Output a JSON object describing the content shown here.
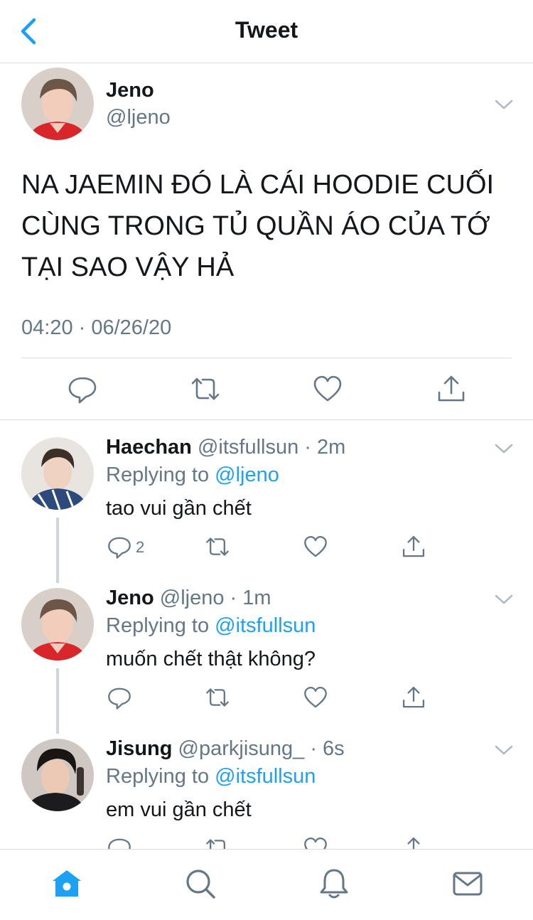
{
  "header": {
    "title": "Tweet",
    "back_icon": "back-chevron-icon"
  },
  "main_tweet": {
    "author_name": "Jeno",
    "handle": "@ljeno",
    "text": "NA JAEMIN ĐÓ LÀ CÁI HOODIE CUỐI CÙNG TRONG TỦ QUẦN ÁO CỦA TỚ TẠI SAO VẬY HẢ",
    "timestamp": "04:20 · 06/26/20",
    "actions": [
      "reply-icon",
      "retweet-icon",
      "like-icon",
      "share-icon"
    ]
  },
  "replies": [
    {
      "name": "Haechan",
      "meta": "@itsfullsun · 2m",
      "replying_prefix": "Replying to ",
      "replying_to": "@ljeno",
      "text": "tao vui gần chết",
      "reply_count": "2"
    },
    {
      "name": "Jeno",
      "meta": "@ljeno · 1m",
      "replying_prefix": "Replying to ",
      "replying_to": "@itsfullsun",
      "text": "muốn chết thật không?",
      "reply_count": ""
    },
    {
      "name": "Jisung",
      "meta": "@parkjisung_ · 6s",
      "replying_prefix": "Replying to ",
      "replying_to": "@itsfullsun",
      "text": "em vui gần chết",
      "reply_count": ""
    }
  ],
  "bottom_nav": [
    "home-icon",
    "search-icon",
    "notifications-icon",
    "messages-icon"
  ],
  "colors": {
    "accent": "#1da1f2",
    "text": "#14171a",
    "muted": "#657786",
    "divider": "#d8dde1",
    "icon": "#657786"
  }
}
